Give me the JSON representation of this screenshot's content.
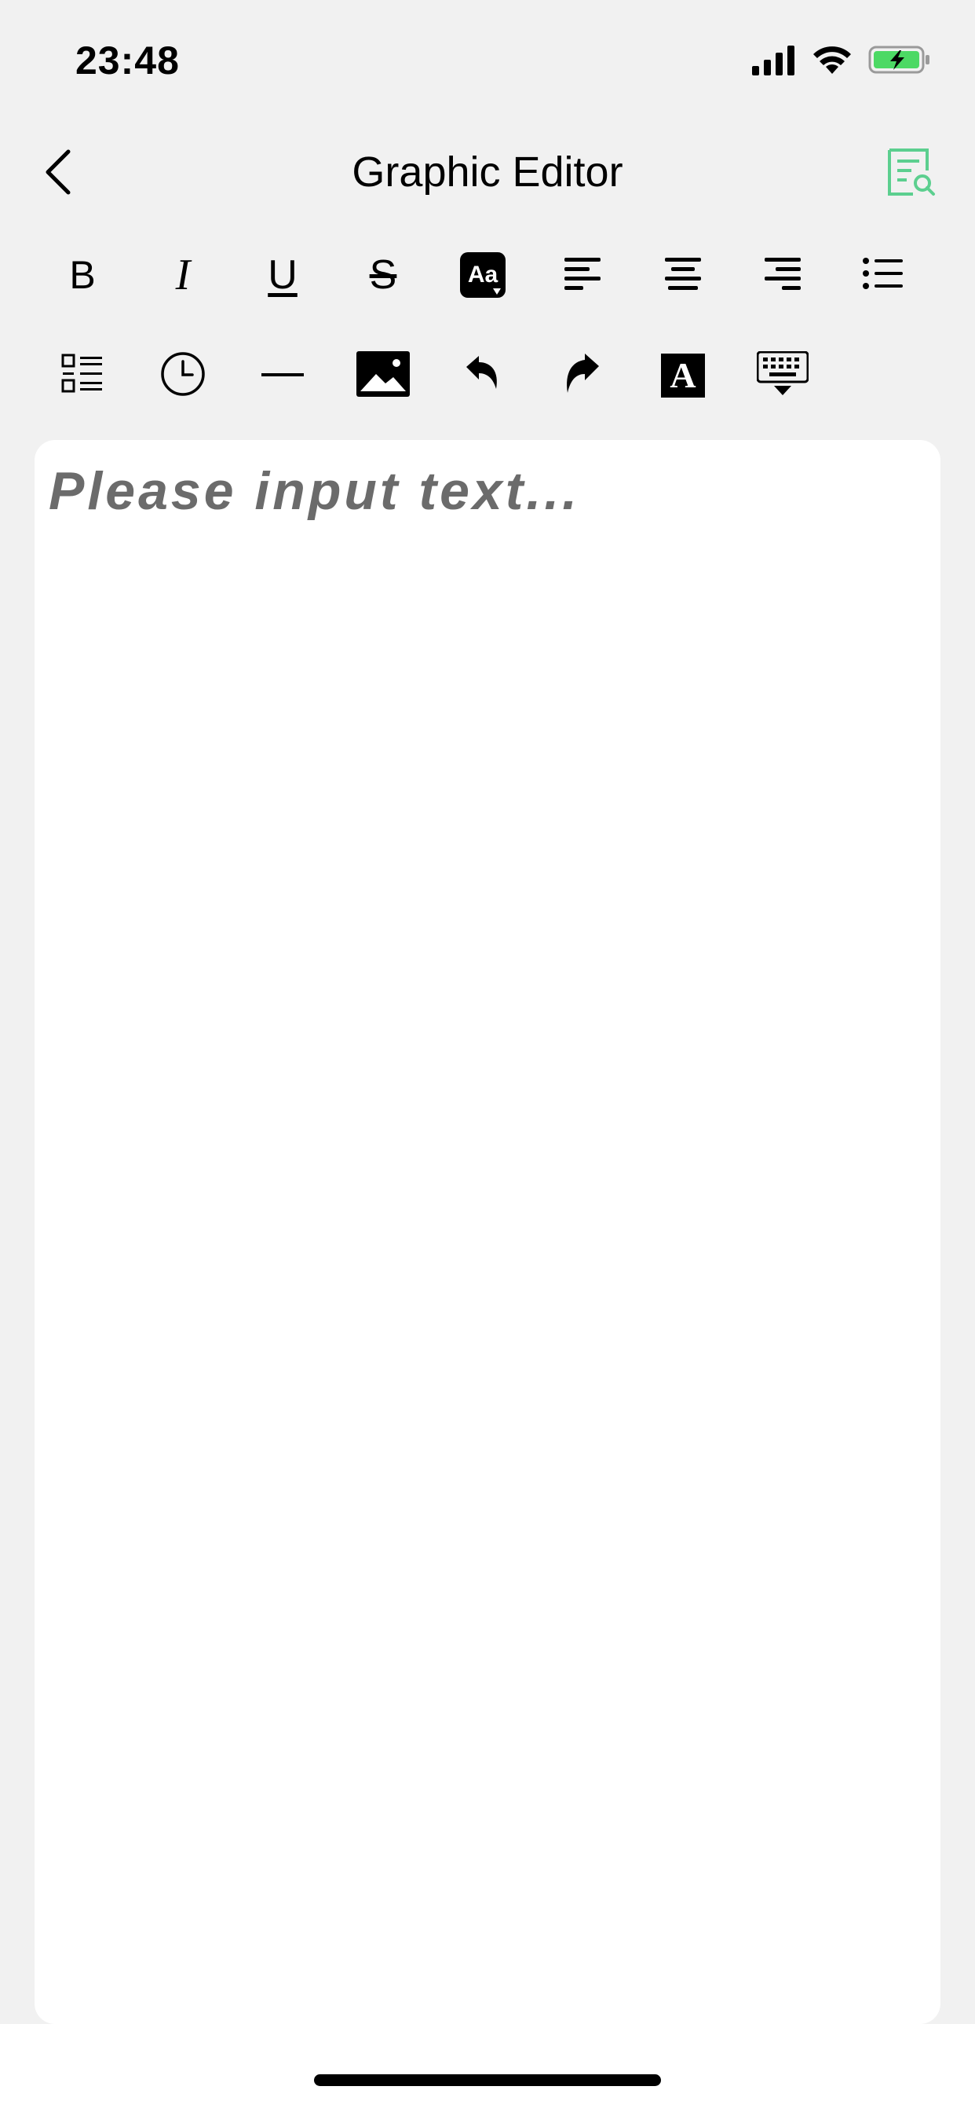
{
  "status_bar": {
    "time": "23:48",
    "icons": [
      "signal-icon",
      "wifi-icon",
      "battery-charging-icon"
    ],
    "battery_color": "#4cd964"
  },
  "nav": {
    "back_icon": "chevron-left-icon",
    "title": "Graphic Editor",
    "preview_icon": "document-search-icon",
    "accent": "#5ccf8f"
  },
  "toolbar": {
    "row1": [
      {
        "name": "bold",
        "label": "B"
      },
      {
        "name": "italic",
        "label": "I"
      },
      {
        "name": "underline",
        "label": "U"
      },
      {
        "name": "strikethrough",
        "label": "S"
      },
      {
        "name": "font-size",
        "label": "Aa"
      },
      {
        "name": "align-left",
        "label": ""
      },
      {
        "name": "align-center",
        "label": ""
      },
      {
        "name": "align-right",
        "label": ""
      },
      {
        "name": "bullet-list",
        "label": ""
      }
    ],
    "row2": [
      {
        "name": "checklist",
        "label": ""
      },
      {
        "name": "time",
        "label": ""
      },
      {
        "name": "horizontal-rule",
        "label": ""
      },
      {
        "name": "insert-image",
        "label": ""
      },
      {
        "name": "undo",
        "label": ""
      },
      {
        "name": "redo",
        "label": ""
      },
      {
        "name": "text-style",
        "label": "A"
      },
      {
        "name": "hide-keyboard",
        "label": ""
      }
    ]
  },
  "editor": {
    "placeholder": "Please input text..."
  }
}
